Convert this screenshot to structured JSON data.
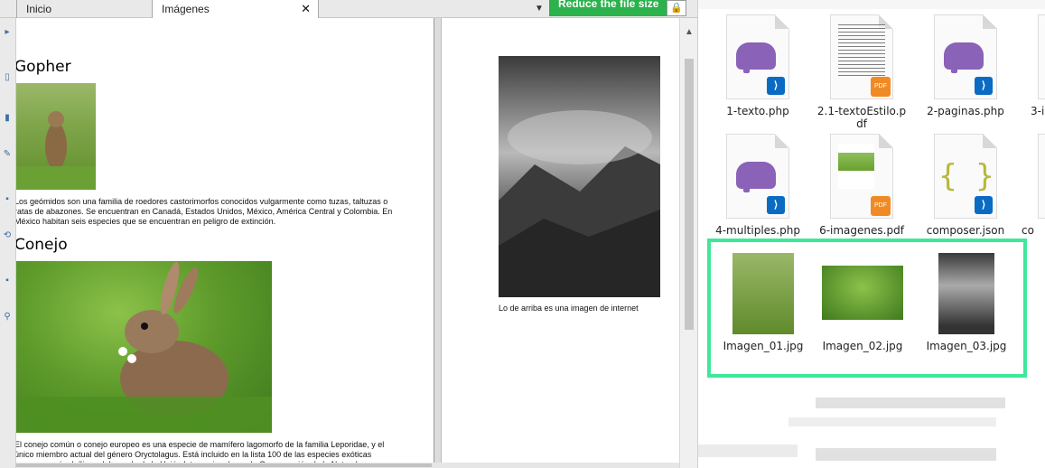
{
  "viewer": {
    "tabs": [
      {
        "label": "Inicio"
      },
      {
        "label": "Imágenes"
      }
    ],
    "close_glyph": "✕",
    "reduce_button": "Reduce the file size",
    "lock_glyph": "🔒",
    "dropdown_glyph": "▼",
    "scroll_up_glyph": "▲",
    "page1": {
      "heading1": "Gopher",
      "para1": "Los geómidos son una familia de roedores castorimorfos conocidos vulgarmente como tuzas, taltuzas o ratas de abazones. Se encuentran en Canadá, Estados Unidos, México, América Central y Colombia. En México habitan seis especies que se encuentran en peligro de extinción.",
      "heading2": "Conejo",
      "para2": "El conejo común o conejo europeo es una especie de mamífero lagomorfo de la familia Leporidae, y el único miembro actual del género Oryctolagus. Está incluido en la lista 100 de las especies exóticas invasoras más dañinas del mundo de la Unión Internacional para la Conservación de la Naturaleza."
    },
    "page2": {
      "caption": "Lo de arriba es una imagen de internet"
    }
  },
  "explorer": {
    "row1": [
      {
        "name": "1-texto.php",
        "icon": "php-elephant-icon"
      },
      {
        "name": "2.1-textoEstilo.pdf",
        "icon": "pdf-document-icon"
      },
      {
        "name": "2-paginas.php",
        "icon": "php-elephant-icon"
      },
      {
        "name": "3-i"
      }
    ],
    "row2": [
      {
        "name": "4-multiples.php",
        "icon": "php-elephant-icon"
      },
      {
        "name": "6-imagenes.pdf",
        "icon": "pdf-document-icon"
      },
      {
        "name": "composer.json",
        "icon": "json-braces-icon"
      },
      {
        "name": "co"
      }
    ],
    "images": [
      {
        "name": "Imagen_01.jpg"
      },
      {
        "name": "Imagen_02.jpg"
      },
      {
        "name": "Imagen_03.jpg"
      }
    ],
    "highlight_color": "#3ee89a"
  },
  "colors": {
    "reduce_button": "#2bb24c",
    "php_icon": "#8a62b8",
    "vscode_badge": "#0a6bc3",
    "pdf_badge": "#f08a24"
  }
}
